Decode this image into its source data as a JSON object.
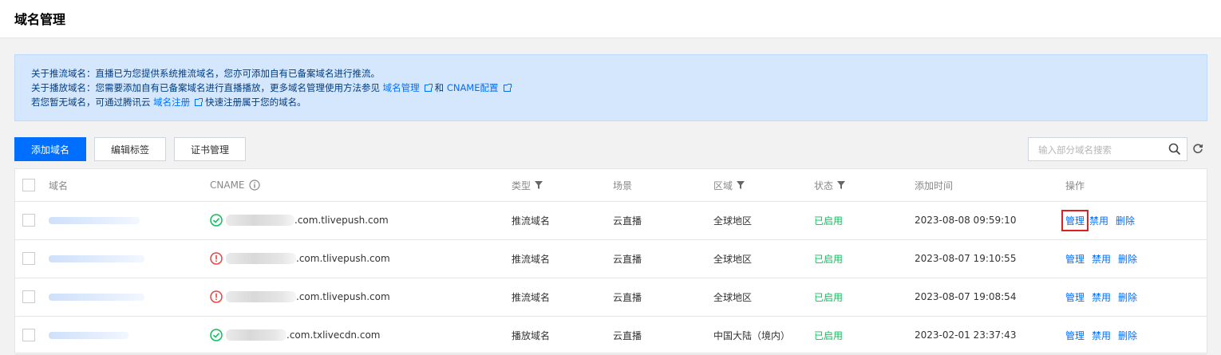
{
  "page": {
    "title": "域名管理"
  },
  "notice": {
    "line1": "关于推流域名：直播已为您提供系统推流域名，您亦可添加自有已备案域名进行推流。",
    "line2_prefix": "关于播放域名：您需要添加自有已备案域名进行直播播放，更多域名管理使用方法参见",
    "line2_link1": "域名管理",
    "line2_and": "和",
    "line2_link2": "CNAME配置",
    "line3_prefix": "若您暂无域名，可通过腾讯云",
    "line3_link": "域名注册",
    "line3_suffix": "快速注册属于您的域名。"
  },
  "toolbar": {
    "add_domain": "添加域名",
    "edit_tags": "编辑标签",
    "cert_manage": "证书管理",
    "search_placeholder": "输入部分域名搜索"
  },
  "table": {
    "headers": {
      "domain": "域名",
      "cname": "CNAME",
      "type": "类型",
      "scene": "场景",
      "region": "区域",
      "status": "状态",
      "added_time": "添加时间",
      "actions": "操作"
    },
    "rows": [
      {
        "cname_suffix": ".com.tlivepush.com",
        "cname_status": "ok",
        "type": "推流域名",
        "scene": "云直播",
        "region": "全球地区",
        "status": "已启用",
        "added_time": "2023-08-08 09:59:10",
        "action_manage": "管理",
        "action_disable": "禁用",
        "action_delete": "删除"
      },
      {
        "cname_suffix": ".com.tlivepush.com",
        "cname_status": "warning",
        "type": "推流域名",
        "scene": "云直播",
        "region": "全球地区",
        "status": "已启用",
        "added_time": "2023-08-07 19:10:55",
        "action_manage": "管理",
        "action_disable": "禁用",
        "action_delete": "删除"
      },
      {
        "cname_suffix": ".com.tlivepush.com",
        "cname_status": "warning",
        "type": "推流域名",
        "scene": "云直播",
        "region": "全球地区",
        "status": "已启用",
        "added_time": "2023-08-07 19:08:54",
        "action_manage": "管理",
        "action_disable": "禁用",
        "action_delete": "删除"
      },
      {
        "cname_suffix": ".com.txlivecdn.com",
        "cname_status": "ok",
        "type": "播放域名",
        "scene": "云直播",
        "region": "中国大陆（境内）",
        "status": "已启用",
        "added_time": "2023-02-01 23:37:43",
        "action_manage": "管理",
        "action_disable": "禁用",
        "action_delete": "删除"
      }
    ]
  },
  "colors": {
    "primary": "#006eff",
    "success": "#0abf5b",
    "error": "#e54545",
    "notice_bg": "#d5e7fd",
    "highlight": "#e02020"
  }
}
